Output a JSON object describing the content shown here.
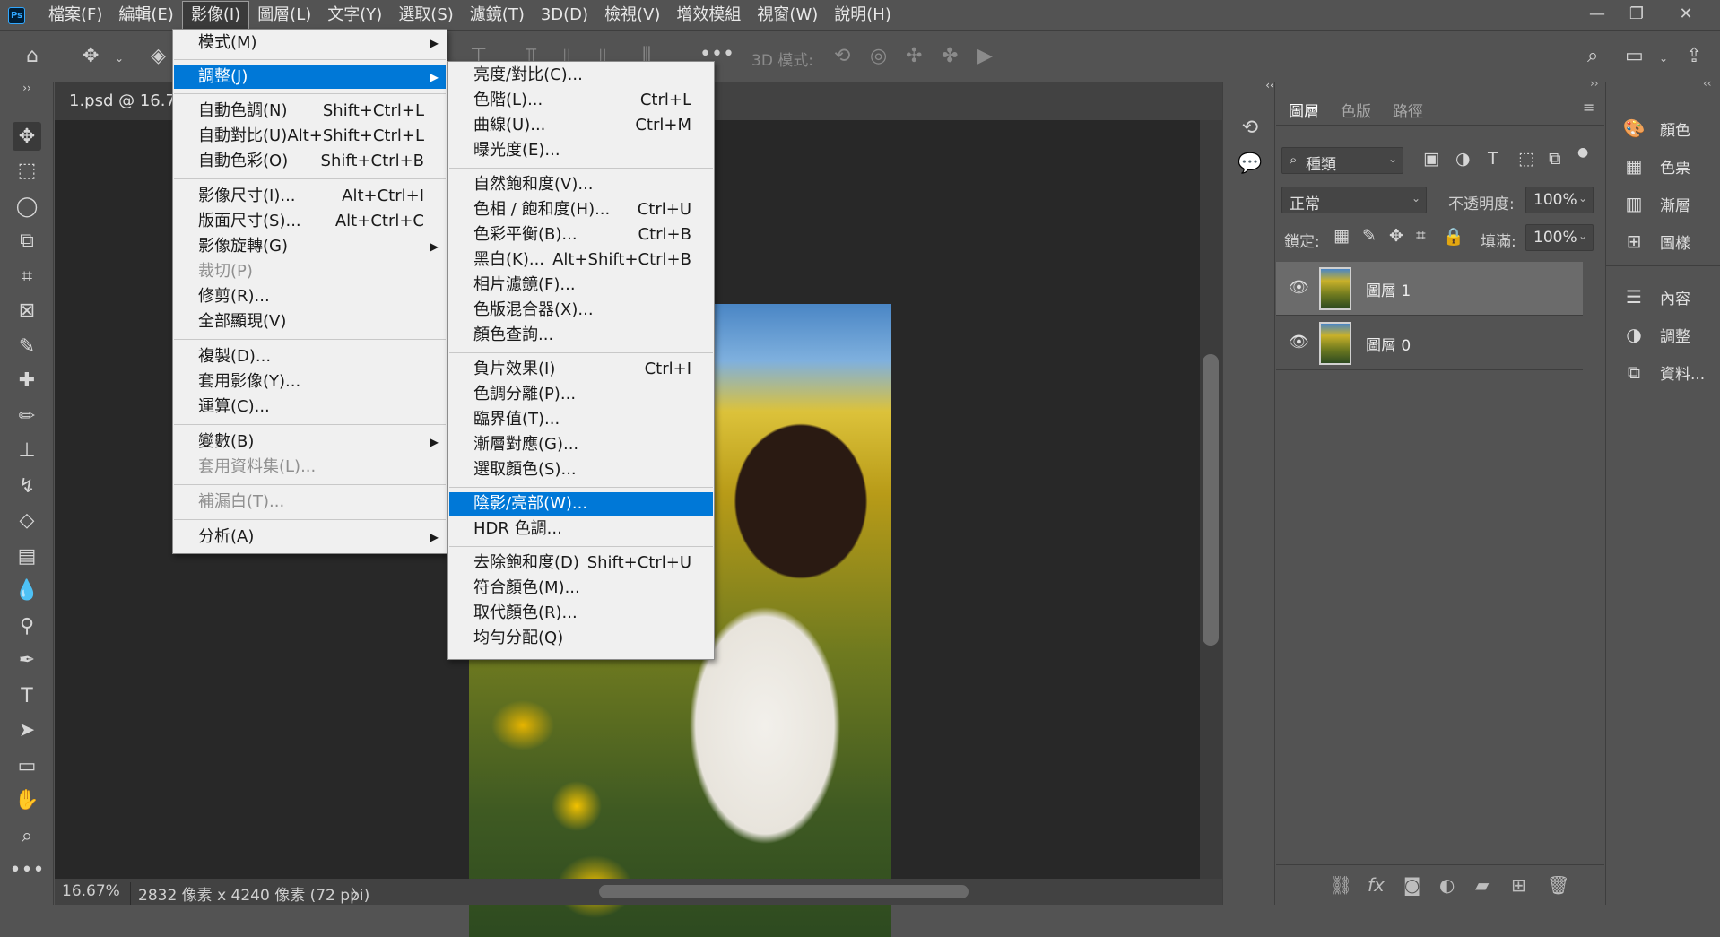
{
  "menubar": {
    "logo": "Ps",
    "items": [
      "檔案(F)",
      "編輯(E)",
      "影像(I)",
      "圖層(L)",
      "文字(Y)",
      "選取(S)",
      "濾鏡(T)",
      "3D(D)",
      "檢視(V)",
      "增效模組",
      "視窗(W)",
      "說明(H)"
    ],
    "open_index": 2
  },
  "window_controls": {
    "minimize": "—",
    "restore": "❐",
    "close": "✕"
  },
  "options_bar": {
    "mode_3d_label": "3D 模式:"
  },
  "document": {
    "tab_title": "1.psd @ 16.7%"
  },
  "status": {
    "zoom": "16.67%",
    "info": "2832 像素 x 4240 像素 (72 ppi)",
    "arrow": "〉"
  },
  "image_menu": {
    "items": [
      {
        "label": "模式(M)",
        "shortcut": "",
        "submenu": true,
        "disabled": false
      },
      {
        "label": "調整(J)",
        "shortcut": "",
        "submenu": true,
        "disabled": false,
        "highlighted": true
      },
      {
        "label": "自動色調(N)",
        "shortcut": "Shift+Ctrl+L",
        "submenu": false,
        "disabled": false
      },
      {
        "label": "自動對比(U)",
        "shortcut": "Alt+Shift+Ctrl+L",
        "submenu": false,
        "disabled": false
      },
      {
        "label": "自動色彩(O)",
        "shortcut": "Shift+Ctrl+B",
        "submenu": false,
        "disabled": false
      },
      {
        "label": "影像尺寸(I)...",
        "shortcut": "Alt+Ctrl+I",
        "submenu": false,
        "disabled": false
      },
      {
        "label": "版面尺寸(S)...",
        "shortcut": "Alt+Ctrl+C",
        "submenu": false,
        "disabled": false
      },
      {
        "label": "影像旋轉(G)",
        "shortcut": "",
        "submenu": true,
        "disabled": false
      },
      {
        "label": "裁切(P)",
        "shortcut": "",
        "submenu": false,
        "disabled": true
      },
      {
        "label": "修剪(R)...",
        "shortcut": "",
        "submenu": false,
        "disabled": false
      },
      {
        "label": "全部顯現(V)",
        "shortcut": "",
        "submenu": false,
        "disabled": false
      },
      {
        "label": "複製(D)...",
        "shortcut": "",
        "submenu": false,
        "disabled": false
      },
      {
        "label": "套用影像(Y)...",
        "shortcut": "",
        "submenu": false,
        "disabled": false
      },
      {
        "label": "運算(C)...",
        "shortcut": "",
        "submenu": false,
        "disabled": false
      },
      {
        "label": "變數(B)",
        "shortcut": "",
        "submenu": true,
        "disabled": false
      },
      {
        "label": "套用資料集(L)...",
        "shortcut": "",
        "submenu": false,
        "disabled": true
      },
      {
        "label": "補漏白(T)...",
        "shortcut": "",
        "submenu": false,
        "disabled": true
      },
      {
        "label": "分析(A)",
        "shortcut": "",
        "submenu": true,
        "disabled": false
      }
    ]
  },
  "adjust_menu": {
    "items": [
      {
        "label": "亮度/對比(C)...",
        "shortcut": ""
      },
      {
        "label": "色階(L)...",
        "shortcut": "Ctrl+L"
      },
      {
        "label": "曲線(U)...",
        "shortcut": "Ctrl+M"
      },
      {
        "label": "曝光度(E)...",
        "shortcut": ""
      },
      {
        "label": "自然飽和度(V)...",
        "shortcut": ""
      },
      {
        "label": "色相 / 飽和度(H)...",
        "shortcut": "Ctrl+U"
      },
      {
        "label": "色彩平衡(B)...",
        "shortcut": "Ctrl+B"
      },
      {
        "label": "黑白(K)...",
        "shortcut": "Alt+Shift+Ctrl+B"
      },
      {
        "label": "相片濾鏡(F)...",
        "shortcut": ""
      },
      {
        "label": "色版混合器(X)...",
        "shortcut": ""
      },
      {
        "label": "顏色查詢...",
        "shortcut": ""
      },
      {
        "label": "負片效果(I)",
        "shortcut": "Ctrl+I"
      },
      {
        "label": "色調分離(P)...",
        "shortcut": ""
      },
      {
        "label": "臨界值(T)...",
        "shortcut": ""
      },
      {
        "label": "漸層對應(G)...",
        "shortcut": ""
      },
      {
        "label": "選取顏色(S)...",
        "shortcut": ""
      },
      {
        "label": "陰影/亮部(W)...",
        "shortcut": "",
        "highlighted": true
      },
      {
        "label": "HDR 色調...",
        "shortcut": ""
      },
      {
        "label": "去除飽和度(D)",
        "shortcut": "Shift+Ctrl+U"
      },
      {
        "label": "符合顏色(M)...",
        "shortcut": ""
      },
      {
        "label": "取代顏色(R)...",
        "shortcut": ""
      },
      {
        "label": "均勻分配(Q)",
        "shortcut": ""
      }
    ]
  },
  "layers_panel": {
    "tabs": [
      "圖層",
      "色版",
      "路徑"
    ],
    "active_tab": 0,
    "filter_kind": "種類",
    "blend_mode": "正常",
    "opacity_label": "不透明度:",
    "opacity_value": "100%",
    "lock_label": "鎖定:",
    "fill_label": "填滿:",
    "fill_value": "100%",
    "layers": [
      {
        "name": "圖層 1",
        "visible": true,
        "selected": true
      },
      {
        "name": "圖層 0",
        "visible": true,
        "selected": false
      }
    ]
  },
  "right_panel": {
    "items": [
      "顏色",
      "色票",
      "漸層",
      "圖樣",
      "內容",
      "調整",
      "資料..."
    ]
  },
  "colors": {
    "menu_highlight": "#0078d7",
    "ui_bg": "#535353",
    "canvas_bg": "#282828"
  }
}
